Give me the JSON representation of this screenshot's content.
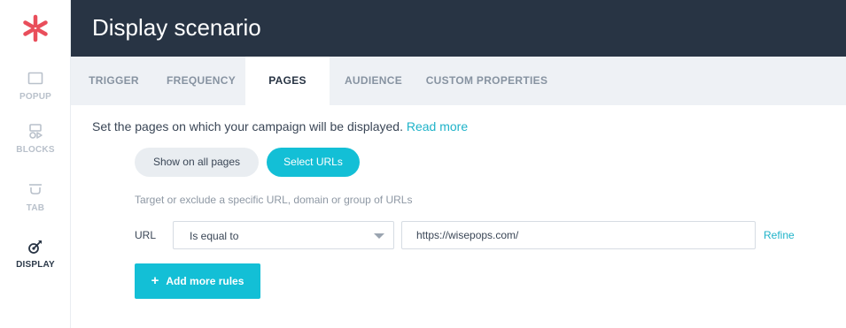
{
  "app": {
    "brand_color": "#e94e5b",
    "accent_color": "#13bfd6",
    "header_color": "#283444"
  },
  "sidebar": {
    "logo_icon": "asterisk-logo-icon",
    "items": [
      {
        "label": "POPUP",
        "icon": "popup-icon",
        "active": false
      },
      {
        "label": "BLOCKS",
        "icon": "blocks-icon",
        "active": false
      },
      {
        "label": "TAB",
        "icon": "tab-icon",
        "active": false
      },
      {
        "label": "DISPLAY",
        "icon": "display-target-icon",
        "active": true
      }
    ]
  },
  "header": {
    "title": "Display scenario"
  },
  "tabs": [
    {
      "label": "TRIGGER",
      "active": false
    },
    {
      "label": "FREQUENCY",
      "active": false
    },
    {
      "label": "PAGES",
      "active": true
    },
    {
      "label": "AUDIENCE",
      "active": false
    },
    {
      "label": "CUSTOM PROPERTIES",
      "active": false
    }
  ],
  "pages": {
    "description": "Set the pages on which your campaign will be displayed.",
    "read_more": "Read more",
    "mode_buttons": [
      {
        "label": "Show on all pages",
        "selected": false
      },
      {
        "label": "Select URLs",
        "selected": true
      }
    ],
    "hint": "Target or exclude a specific URL, domain or group of URLs",
    "rule": {
      "label": "URL",
      "operator": "Is equal to",
      "value": "https://wisepops.com/",
      "refine_label": "Refine"
    },
    "add_rules_label": "Add more rules",
    "add_rules_icon": "plus-icon"
  }
}
